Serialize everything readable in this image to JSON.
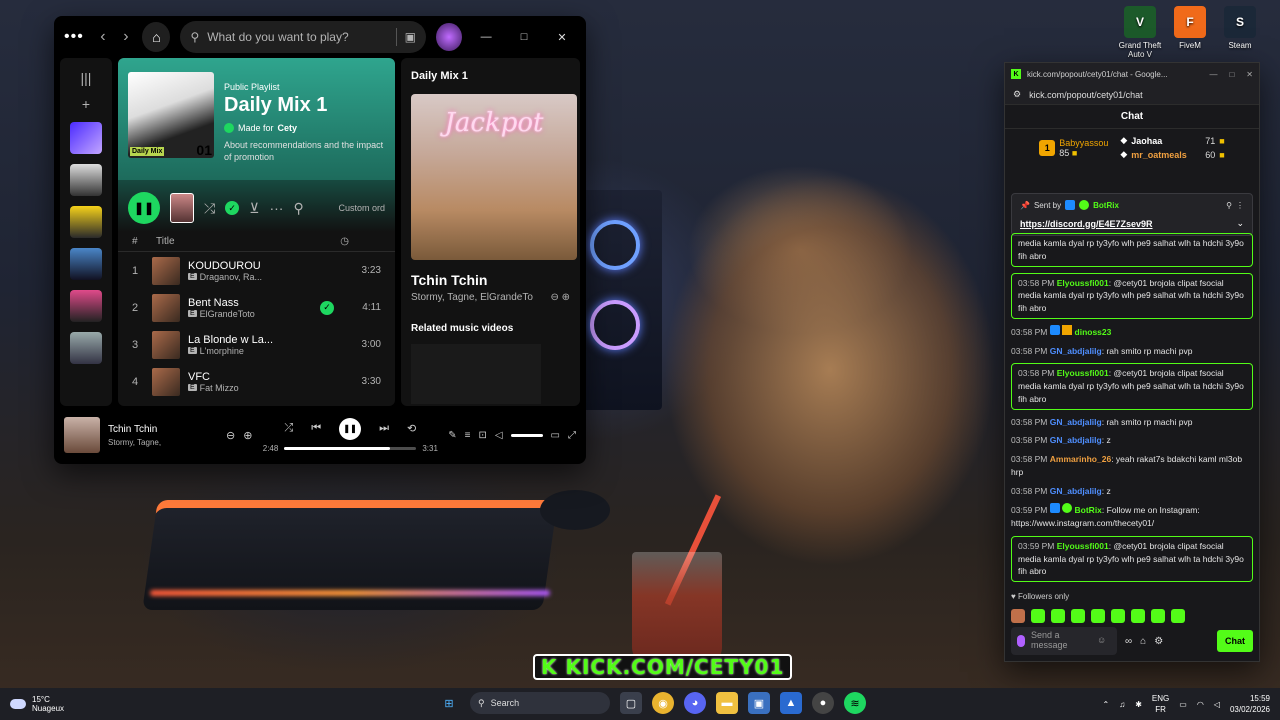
{
  "desktop": {
    "icons": [
      {
        "label": "Grand Theft Auto V",
        "color": "#1c5a2a",
        "glyph": "V"
      },
      {
        "label": "FiveM",
        "color": "#f06a1a",
        "glyph": "F"
      },
      {
        "label": "Steam",
        "color": "#1b2838",
        "glyph": "S"
      }
    ]
  },
  "spotify": {
    "search_placeholder": "What do you want to play?",
    "playlist": {
      "kind": "Public Playlist",
      "title": "Daily Mix 1",
      "made_for_prefix": "Made for",
      "made_for_user": "Cety",
      "description": "About recommendations and the impact of promotion",
      "cover_tag": "Daily Mix",
      "cover_num": "01"
    },
    "custom_order": "Custom ord",
    "table_header": {
      "hash": "#",
      "title": "Title"
    },
    "tracks": [
      {
        "n": "1",
        "title": "KOUDOUROU",
        "artist": "Draganov, Ra...",
        "duration": "3:23",
        "liked": false
      },
      {
        "n": "2",
        "title": "Bent Nass",
        "artist": "ElGrandeToto",
        "duration": "4:11",
        "liked": true
      },
      {
        "n": "3",
        "title": "La Blonde w La...",
        "artist": "L'morphine",
        "duration": "3:00",
        "liked": false
      },
      {
        "n": "4",
        "title": "VFC",
        "artist": "Fat Mizzo",
        "duration": "3:30",
        "liked": false
      }
    ],
    "side": {
      "header": "Daily Mix 1",
      "cover_text": "Jackpot",
      "song": "Tchin Tchin",
      "artists": "Stormy, Tagne, ElGrandeTo",
      "related": "Related music videos"
    },
    "player": {
      "title": "Tchin Tchin",
      "artists": "Stormy, Tagne, ",
      "elapsed": "2:48",
      "total": "3:31",
      "progress": 0.8
    }
  },
  "kick": {
    "window_title": "kick.com/popout/cety01/chat - Google...",
    "url": "kick.com/popout/cety01/chat",
    "chat_header": "Chat",
    "leaderboard": {
      "first": {
        "rank": "1",
        "name": "Babyyassou",
        "value": "85"
      },
      "others": [
        {
          "name": "Jaohaa",
          "value": "71"
        },
        {
          "name": "mr_oatmeals",
          "value": "60"
        }
      ]
    },
    "pinned": {
      "sent_by": "Sent by",
      "user": "BotRix",
      "link": "https://discord.gg/E4E7Zsev9R"
    },
    "messages": [
      {
        "time": "",
        "user": "",
        "text": "media kamla dyal rp ty3yfo wlh pe9 salhat wlh ta hdchi 3y9o fih abro",
        "color": "green",
        "highlight": true
      },
      {
        "time": "03:58 PM",
        "user": "Elyoussfi001",
        "text": "@cety01 brojola clipat fsocial media kamla dyal rp ty3yfo wlh pe9 salhat wlh ta hdchi 3y9o fih abro",
        "color": "green",
        "highlight": true
      },
      {
        "time": "03:58 PM",
        "user": "dinoss23",
        "text": "",
        "color": "green",
        "highlight": false
      },
      {
        "time": "03:58 PM",
        "user": "GN_abdjalilg",
        "text": "rah smito rp machi pvp",
        "color": "blue",
        "highlight": false
      },
      {
        "time": "03:58 PM",
        "user": "Elyoussfi001",
        "text": "@cety01 brojola clipat fsocial media kamla dyal rp ty3yfo wlh pe9 salhat wlh ta hdchi 3y9o fih abro",
        "color": "green",
        "highlight": true
      },
      {
        "time": "03:58 PM",
        "user": "GN_abdjalilg",
        "text": "rah smito rp machi pvp",
        "color": "blue",
        "highlight": false
      },
      {
        "time": "03:58 PM",
        "user": "GN_abdjalilg",
        "text": "z",
        "color": "blue",
        "highlight": false
      },
      {
        "time": "03:58 PM",
        "user": "Ammarinho_26",
        "text": "yeah rakat7s bdakchi kaml ml3ob hrp",
        "color": "orange",
        "highlight": false
      },
      {
        "time": "03:58 PM",
        "user": "GN_abdjalilg",
        "text": "z",
        "color": "blue",
        "highlight": false
      },
      {
        "time": "03:59 PM",
        "user": "BotRix",
        "text": "Follow me on Instagram: https://www.instagram.com/thecety01/",
        "color": "green",
        "highlight": false
      },
      {
        "time": "03:59 PM",
        "user": "Elyoussfi001",
        "text": "@cety01 brojola clipat fsocial media kamla dyal rp ty3yfo wlh pe9 salhat wlh ta hdchi 3y9o fih abro",
        "color": "green",
        "highlight": true
      }
    ],
    "followers_only": "Followers only",
    "send_placeholder": "Send a message",
    "send_button": "Chat"
  },
  "banner": "K KICK.COM/CETY01",
  "taskbar": {
    "temp": "15°C",
    "weather": "Nuageux",
    "search": "Search",
    "lang_top": "ENG",
    "lang_bottom": "FR",
    "time": "15:59",
    "date": "03/02/2026"
  }
}
